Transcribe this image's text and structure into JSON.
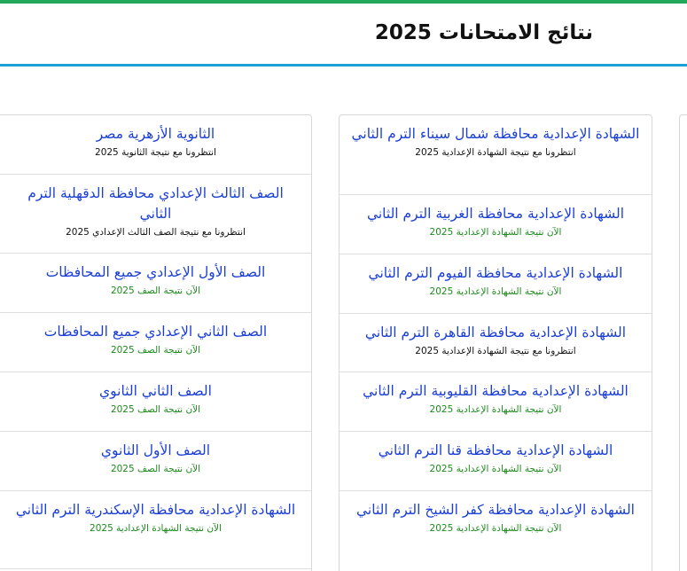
{
  "header": {
    "title": "نتائج الامتحانات 2025"
  },
  "colors": {
    "top_strip": "#22a65a",
    "header_line": "#1aa1d6",
    "link": "#1b3fd6",
    "note_now": "#1c8a1c",
    "note_wait": "#111111"
  },
  "middle": [
    {
      "title": "الشهادة الإعدادية محافظة شمال سيناء الترم الثاني",
      "note": "انتظرونا مع نتيجة الشهادة الإعدادية 2025"
    },
    {
      "title": "الشهادة الإعدادية محافظة الغربية الترم الثاني",
      "note": "الآن نتيجة الشهادة الإعدادية 2025"
    },
    {
      "title": "الشهادة الإعدادية محافظة الفيوم الترم الثاني",
      "note": "الآن نتيجة الشهادة الإعدادية 2025"
    },
    {
      "title": "الشهادة الإعدادية محافظة القاهرة الترم الثاني",
      "note": "انتظرونا مع نتيجة الشهادة الإعدادية 2025"
    },
    {
      "title": "الشهادة الإعدادية محافظة القليوبية الترم الثاني",
      "note": "الآن نتيجة الشهادة الإعدادية 2025"
    },
    {
      "title": "الشهادة الإعدادية محافظة قنا الترم الثاني",
      "note": "الآن نتيجة الشهادة الإعدادية 2025"
    },
    {
      "title": "الشهادة الإعدادية محافظة كفر الشيخ الترم الثاني",
      "note": "الآن نتيجة الشهادة الإعدادية 2025"
    }
  ],
  "left": [
    {
      "title": "الثانوية الأزهرية مصر",
      "note": "انتظرونا مع نتيجة الثانوية 2025"
    },
    {
      "title": "الصف الثالث الإعدادي محافظة الدقهلية الترم الثاني",
      "note": "انتظرونا مع نتيجة الصف الثالث الإعدادي 2025"
    },
    {
      "title": "الصف الأول الإعدادي جميع المحافظات",
      "note": "الآن نتيجة الصف 2025"
    },
    {
      "title": "الصف الثاني الإعدادي جميع المحافظات",
      "note": "الآن نتيجة الصف 2025"
    },
    {
      "title": "الصف الثاني الثانوي",
      "note": "الآن نتيجة الصف 2025"
    },
    {
      "title": "الصف الأول الثانوي",
      "note": "الآن نتيجة الصف 2025"
    },
    {
      "title": "الشهادة الإعدادية محافظة الإسكندرية الترم الثاني",
      "note": "الآن نتيجة الشهادة الإعدادية 2025"
    }
  ]
}
